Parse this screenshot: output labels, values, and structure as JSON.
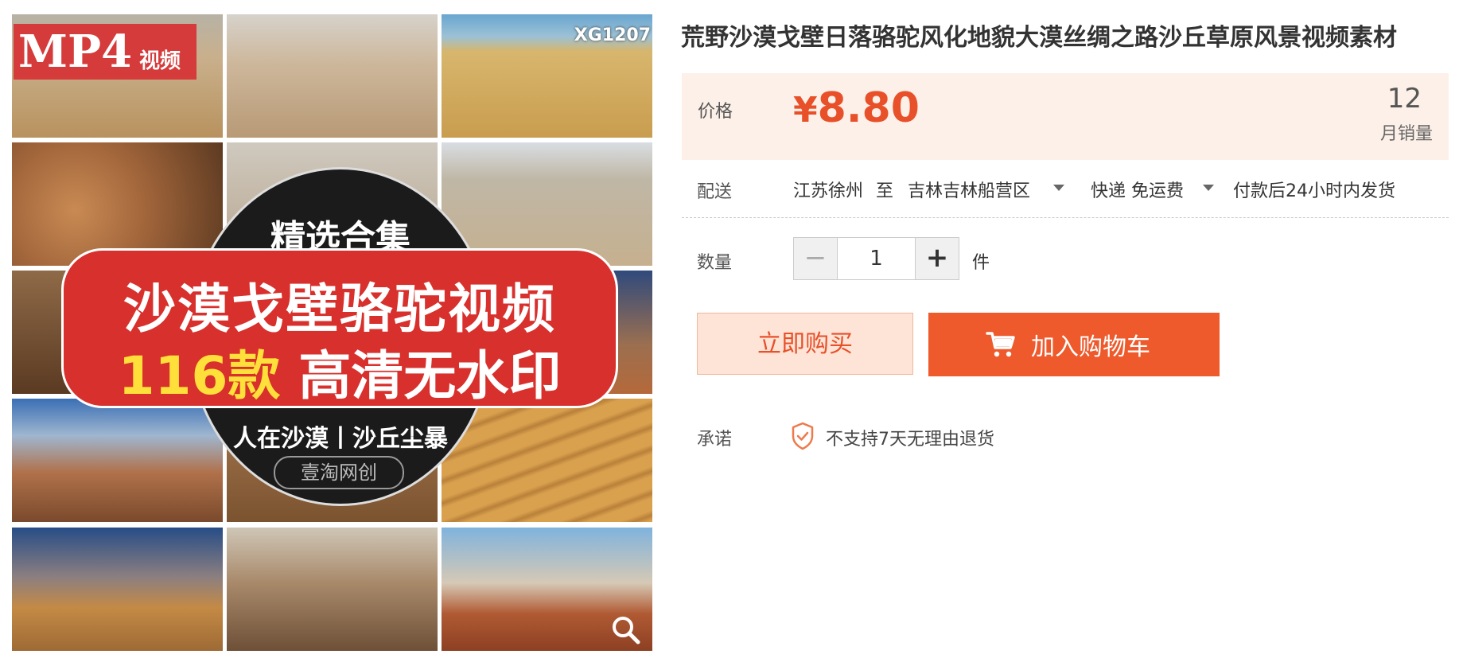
{
  "product_image": {
    "badge": {
      "format": "MP4",
      "label": "视频"
    },
    "code": "XG1207",
    "circle_top": "精选合集",
    "banner_line1": "沙漠戈壁骆驼视频",
    "banner_count": "116款",
    "banner_rest": "高清无水印",
    "circle_sub": "人在沙漠丨沙丘尘暴",
    "brand": "壹淘网创"
  },
  "product": {
    "title": "荒野沙漠戈壁日落骆驼风化地貌大漠丝绸之路沙丘草原风景视频素材"
  },
  "price": {
    "label": "价格",
    "currency": "¥",
    "amount": "8.80",
    "sales_count": "12",
    "sales_label": "月销量"
  },
  "delivery": {
    "label": "配送",
    "origin": "江苏徐州",
    "to": "至",
    "destination": "吉林吉林船营区",
    "shipping": "快递 免运费",
    "dispatch": "付款后24小时内发货"
  },
  "quantity": {
    "label": "数量",
    "minus": "−",
    "value": "1",
    "plus": "+",
    "unit": "件"
  },
  "actions": {
    "buy_now": "立即购买",
    "add_to_cart": "加入购物车"
  },
  "promise": {
    "label": "承诺",
    "text": "不支持7天无理由退货"
  },
  "colors": {
    "accent": "#ee5a2c",
    "price": "#e8502a",
    "price_panel_bg": "#fdf0e8"
  }
}
